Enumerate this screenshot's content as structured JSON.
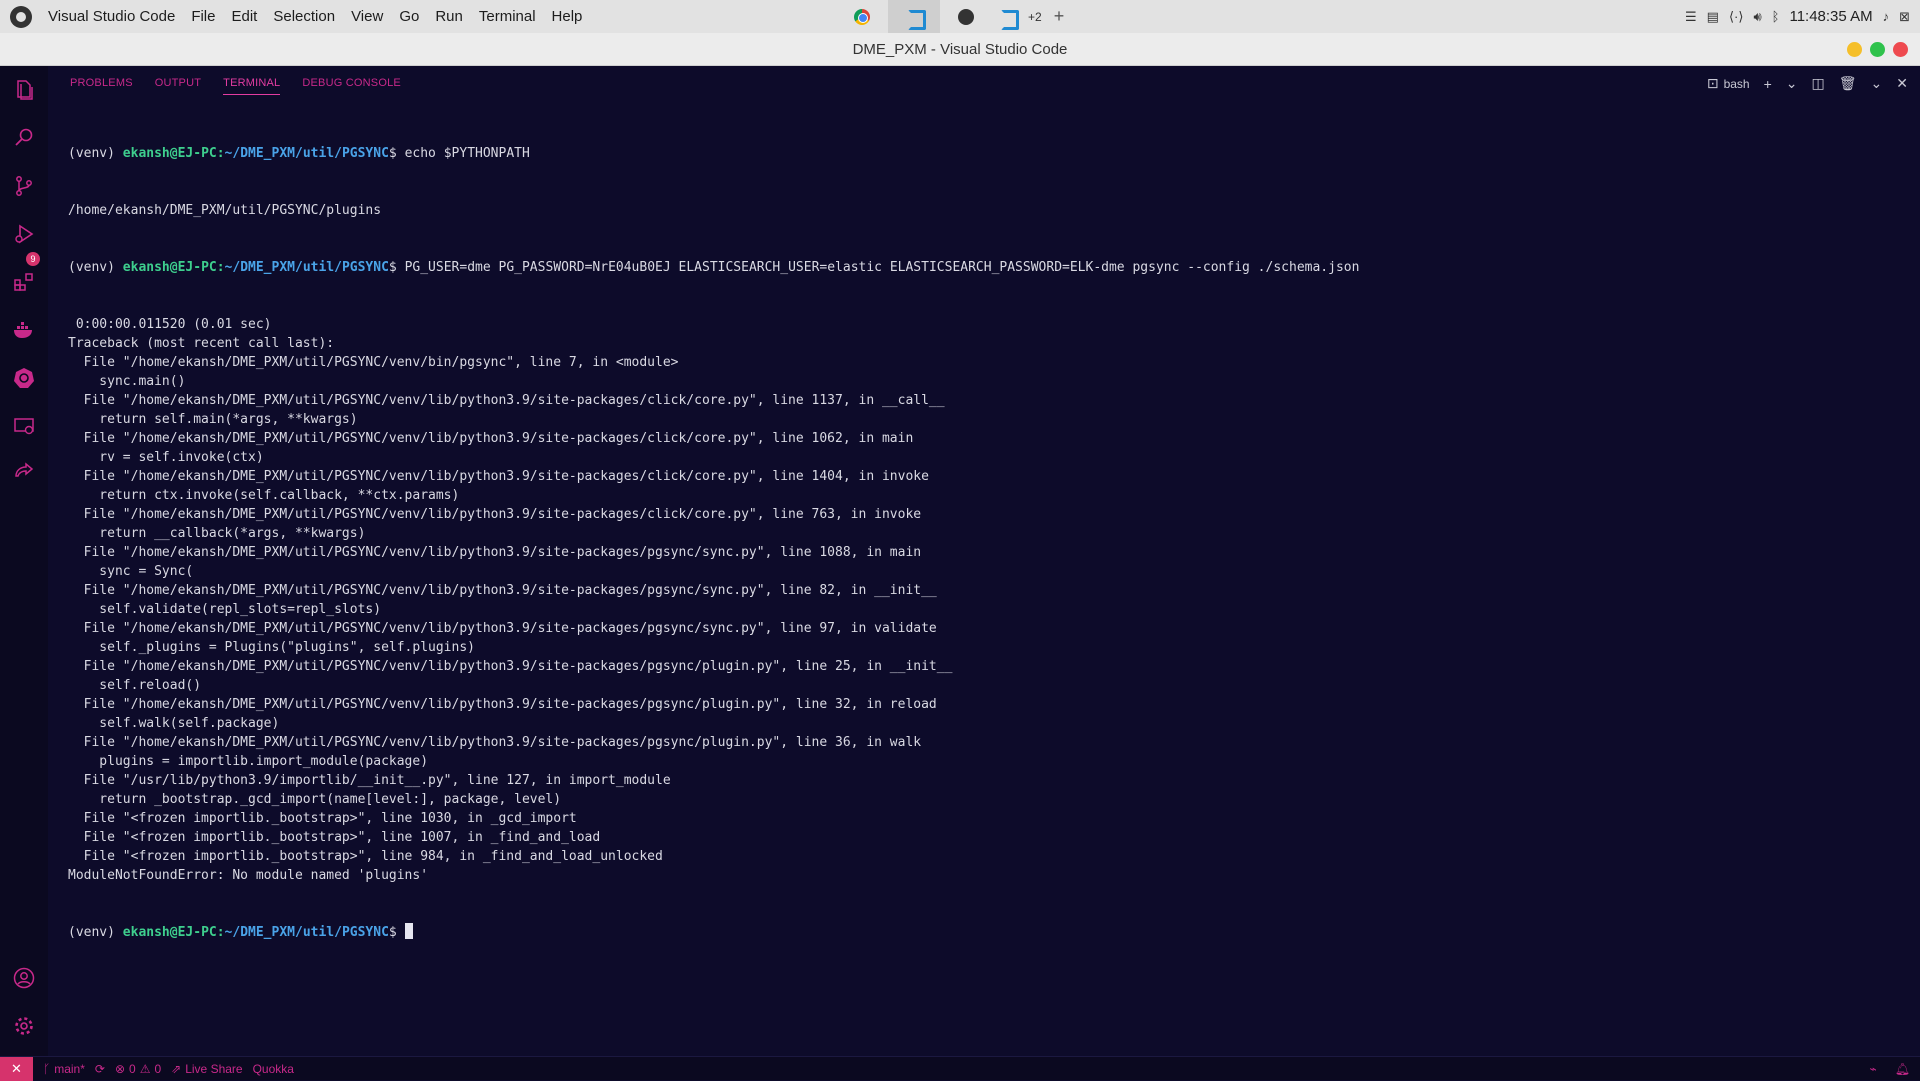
{
  "system_bar": {
    "app_name": "Visual Studio Code",
    "menu": [
      "File",
      "Edit",
      "Selection",
      "View",
      "Go",
      "Run",
      "Terminal",
      "Help"
    ],
    "task_more": "+2",
    "clock": "11:48:35 AM"
  },
  "window": {
    "title": "DME_PXM - Visual Studio Code"
  },
  "panel": {
    "tabs": [
      "PROBLEMS",
      "OUTPUT",
      "TERMINAL",
      "DEBUG CONSOLE"
    ],
    "active_tab": "TERMINAL",
    "shell_name": "bash"
  },
  "terminal": {
    "prompt": {
      "venv": "(venv) ",
      "user": "ekansh@EJ-PC",
      "sep": ":",
      "path": "~/DME_PXM/util/PGSYNC",
      "dollar": "$ "
    },
    "commands": [
      "echo $PYTHONPATH",
      "PG_USER=dme PG_PASSWORD=NrE04uB0EJ ELASTICSEARCH_USER=elastic ELASTICSEARCH_PASSWORD=ELK-dme pgsync --config ./schema.json"
    ],
    "echo_output": "/home/ekansh/DME_PXM/util/PGSYNC/plugins",
    "output_lines": [
      " 0:00:00.011520 (0.01 sec)",
      "Traceback (most recent call last):",
      "  File \"/home/ekansh/DME_PXM/util/PGSYNC/venv/bin/pgsync\", line 7, in <module>",
      "    sync.main()",
      "  File \"/home/ekansh/DME_PXM/util/PGSYNC/venv/lib/python3.9/site-packages/click/core.py\", line 1137, in __call__",
      "    return self.main(*args, **kwargs)",
      "  File \"/home/ekansh/DME_PXM/util/PGSYNC/venv/lib/python3.9/site-packages/click/core.py\", line 1062, in main",
      "    rv = self.invoke(ctx)",
      "  File \"/home/ekansh/DME_PXM/util/PGSYNC/venv/lib/python3.9/site-packages/click/core.py\", line 1404, in invoke",
      "    return ctx.invoke(self.callback, **ctx.params)",
      "  File \"/home/ekansh/DME_PXM/util/PGSYNC/venv/lib/python3.9/site-packages/click/core.py\", line 763, in invoke",
      "    return __callback(*args, **kwargs)",
      "  File \"/home/ekansh/DME_PXM/util/PGSYNC/venv/lib/python3.9/site-packages/pgsync/sync.py\", line 1088, in main",
      "    sync = Sync(",
      "  File \"/home/ekansh/DME_PXM/util/PGSYNC/venv/lib/python3.9/site-packages/pgsync/sync.py\", line 82, in __init__",
      "    self.validate(repl_slots=repl_slots)",
      "  File \"/home/ekansh/DME_PXM/util/PGSYNC/venv/lib/python3.9/site-packages/pgsync/sync.py\", line 97, in validate",
      "    self._plugins = Plugins(\"plugins\", self.plugins)",
      "  File \"/home/ekansh/DME_PXM/util/PGSYNC/venv/lib/python3.9/site-packages/pgsync/plugin.py\", line 25, in __init__",
      "    self.reload()",
      "  File \"/home/ekansh/DME_PXM/util/PGSYNC/venv/lib/python3.9/site-packages/pgsync/plugin.py\", line 32, in reload",
      "    self.walk(self.package)",
      "  File \"/home/ekansh/DME_PXM/util/PGSYNC/venv/lib/python3.9/site-packages/pgsync/plugin.py\", line 36, in walk",
      "    plugins = importlib.import_module(package)",
      "  File \"/usr/lib/python3.9/importlib/__init__.py\", line 127, in import_module",
      "    return _bootstrap._gcd_import(name[level:], package, level)",
      "  File \"<frozen importlib._bootstrap>\", line 1030, in _gcd_import",
      "  File \"<frozen importlib._bootstrap>\", line 1007, in _find_and_load",
      "  File \"<frozen importlib._bootstrap>\", line 984, in _find_and_load_unlocked",
      "ModuleNotFoundError: No module named 'plugins'"
    ]
  },
  "statusbar": {
    "branch": "main*",
    "errors": "0",
    "warnings": "0",
    "live_share": "Live Share",
    "quokka": "Quokka"
  },
  "colors": {
    "accent": "#c8298a",
    "terminal_bg": "#0d0b2a",
    "prompt_user": "#3ecf8e",
    "prompt_path": "#4aa3e8"
  }
}
